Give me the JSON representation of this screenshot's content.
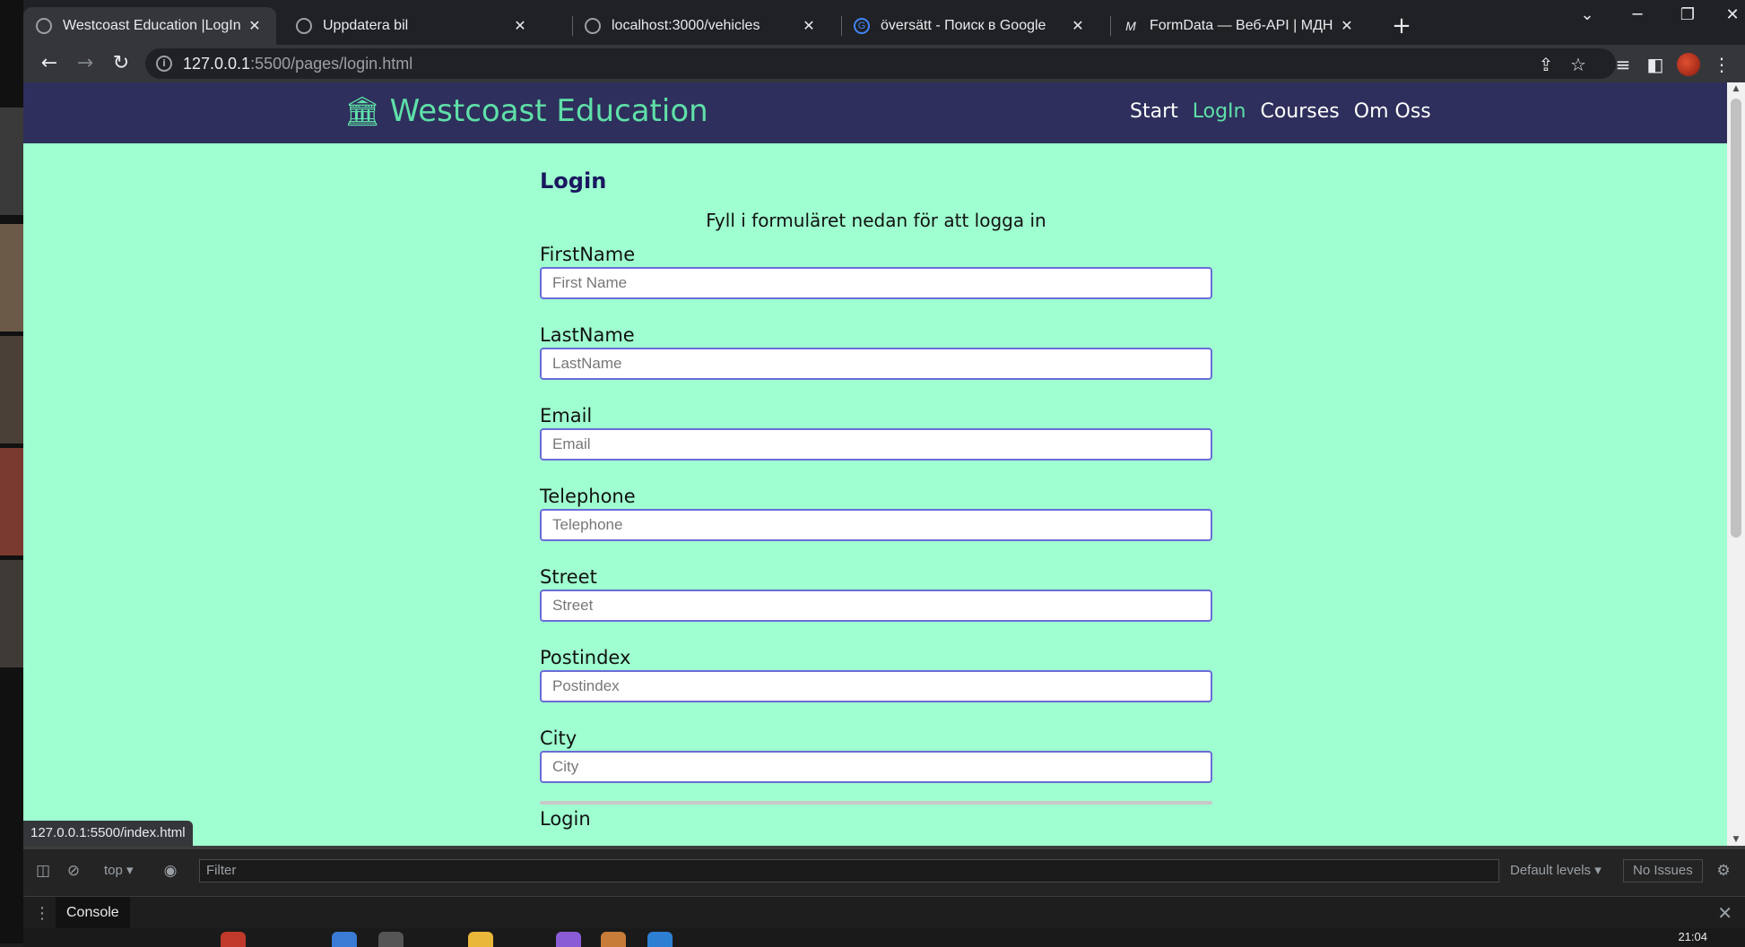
{
  "tabs": [
    {
      "title": "Westcoast Education |LogIn",
      "favicon": "globe-icon",
      "active": true
    },
    {
      "title": "Uppdatera bil",
      "favicon": "globe-icon",
      "active": false
    },
    {
      "title": "localhost:3000/vehicles",
      "favicon": "globe-icon",
      "active": false
    },
    {
      "title": "översätt - Поиск в Google",
      "favicon": "google-icon",
      "active": false
    },
    {
      "title": "FormData — Веб-API | МДН",
      "favicon": "mdn-icon",
      "active": false
    }
  ],
  "address": {
    "host": "127.0.0.1",
    "path": ":5500/pages/login.html"
  },
  "site": {
    "brand": "Westcoast Education",
    "nav": [
      {
        "label": "Start"
      },
      {
        "label": "LogIn"
      },
      {
        "label": "Courses"
      },
      {
        "label": "Om Oss"
      }
    ]
  },
  "form": {
    "title": "Login",
    "subtitle": "Fyll i formuläret nedan för att logga in",
    "fields": [
      {
        "label": "FirstName",
        "placeholder": "First Name"
      },
      {
        "label": "LastName",
        "placeholder": "LastName"
      },
      {
        "label": "Email",
        "placeholder": "Email"
      },
      {
        "label": "Telephone",
        "placeholder": "Telephone"
      },
      {
        "label": "Street",
        "placeholder": "Street"
      },
      {
        "label": "Postindex",
        "placeholder": "Postindex"
      },
      {
        "label": "City",
        "placeholder": "City"
      }
    ],
    "section_label": "Login"
  },
  "status_url": "127.0.0.1:5500/index.html",
  "devtools": {
    "context": "top",
    "filter_placeholder": "Filter",
    "levels": "Default levels",
    "issues": "No Issues",
    "tab": "Console"
  },
  "taskbar": {
    "clock": "21:04"
  },
  "colors": {
    "page_bg": "#9fffd0",
    "header_bg": "#2e2f5c",
    "accent": "#5fe0a8",
    "title": "#1a1760"
  }
}
